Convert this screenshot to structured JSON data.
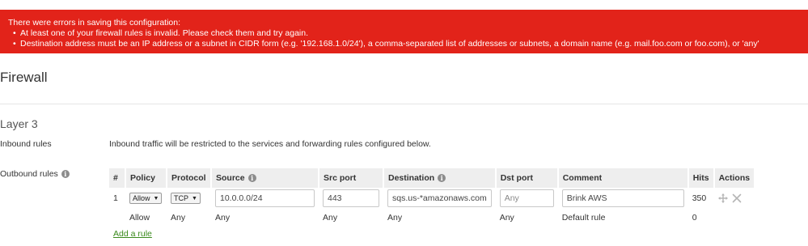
{
  "error": {
    "heading": "There were errors in saving this configuration:",
    "items": [
      "At least one of your firewall rules is invalid. Please check them and try again.",
      "Destination address must be an IP address or a subnet in CIDR form (e.g. '192.168.1.0/24'), a comma-separated list of addresses or subnets, a domain name (e.g. mail.foo.com or foo.com), or 'any'"
    ],
    "bullet": "•"
  },
  "page": {
    "title": "Firewall"
  },
  "layer3": {
    "title": "Layer 3",
    "inbound_label": "Inbound rules",
    "inbound_text": "Inbound traffic will be restricted to the services and forwarding rules configured below.",
    "outbound_label": "Outbound rules"
  },
  "table": {
    "headers": {
      "num": "#",
      "policy": "Policy",
      "protocol": "Protocol",
      "source": "Source",
      "src_port": "Src port",
      "destination": "Destination",
      "dst_port": "Dst port",
      "comment": "Comment",
      "hits": "Hits",
      "actions": "Actions"
    },
    "rule": {
      "num": "1",
      "policy": "Allow",
      "protocol": "TCP",
      "source": "10.0.0.0/24",
      "src_port": "443",
      "destination": "sqs.us-*amazonaws.com",
      "dst_port": "Any",
      "comment": "Brink AWS",
      "hits": "350"
    },
    "default_rule": {
      "policy": "Allow",
      "protocol": "Any",
      "source": "Any",
      "src_port": "Any",
      "destination": "Any",
      "dst_port": "Any",
      "comment": "Default rule",
      "hits": "0"
    },
    "add_rule": "Add a rule"
  },
  "icons": {
    "info": "info-icon",
    "move": "move-icon",
    "delete": "close-icon",
    "caret": "▼"
  },
  "colors": {
    "error_bg": "#e2231a",
    "link": "#3b8a1d"
  }
}
